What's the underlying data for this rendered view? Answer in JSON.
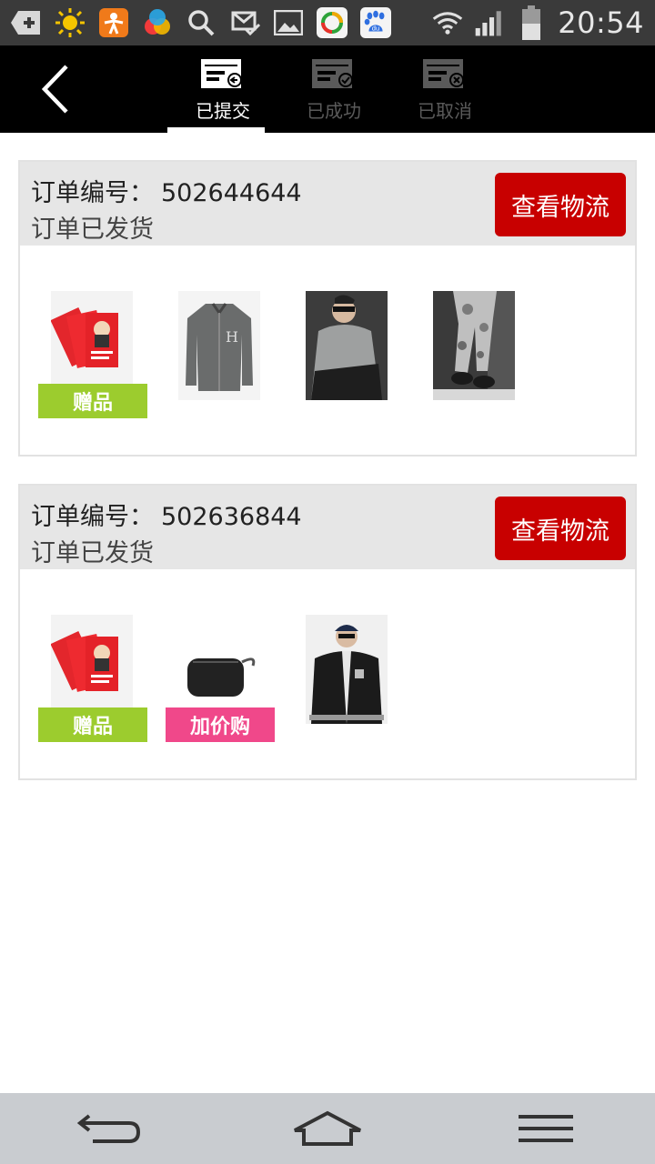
{
  "status_bar": {
    "time": "20:54",
    "icons": [
      "add-icon",
      "sun-icon",
      "app-icon",
      "circles-icon",
      "search-icon",
      "mail-check-icon",
      "gallery-icon",
      "browser-icon",
      "baidu-icon",
      "wifi-icon",
      "signal-icon",
      "battery-icon"
    ]
  },
  "header": {
    "tabs": [
      {
        "label": "已提交",
        "icon": "submitted-icon",
        "active": true
      },
      {
        "label": "已成功",
        "icon": "success-icon",
        "active": false
      },
      {
        "label": "已取消",
        "icon": "cancelled-icon",
        "active": false
      }
    ]
  },
  "orders": [
    {
      "order_label": "订单编号：",
      "order_number": "502644644",
      "status": "订单已发货",
      "button_label": "查看物流",
      "products": [
        {
          "image": "red-cards-image",
          "tag": "赠品"
        },
        {
          "image": "grey-jacket-image",
          "tag": ""
        },
        {
          "image": "sweatshirt-man-image",
          "tag": ""
        },
        {
          "image": "camo-pants-image",
          "tag": ""
        }
      ]
    },
    {
      "order_label": "订单编号：",
      "order_number": "502636844",
      "status": "订单已发货",
      "button_label": "查看物流",
      "products": [
        {
          "image": "red-cards-image",
          "tag": "赠品"
        },
        {
          "image": "black-pouch-image",
          "tag": "加价购"
        },
        {
          "image": "baseball-jacket-man-image",
          "tag": ""
        }
      ]
    }
  ],
  "colors": {
    "status_bar": "#3a3a3a",
    "header": "#000000",
    "logistics_button": "#c80000",
    "gift_tag": "#9ccc2e",
    "addon_tag": "#f0488a",
    "order_head": "#e6e6e6",
    "navbar": "#c9ccd0"
  },
  "navbar": {
    "buttons": [
      "back-arrow-icon",
      "home-icon",
      "menu-icon"
    ]
  }
}
